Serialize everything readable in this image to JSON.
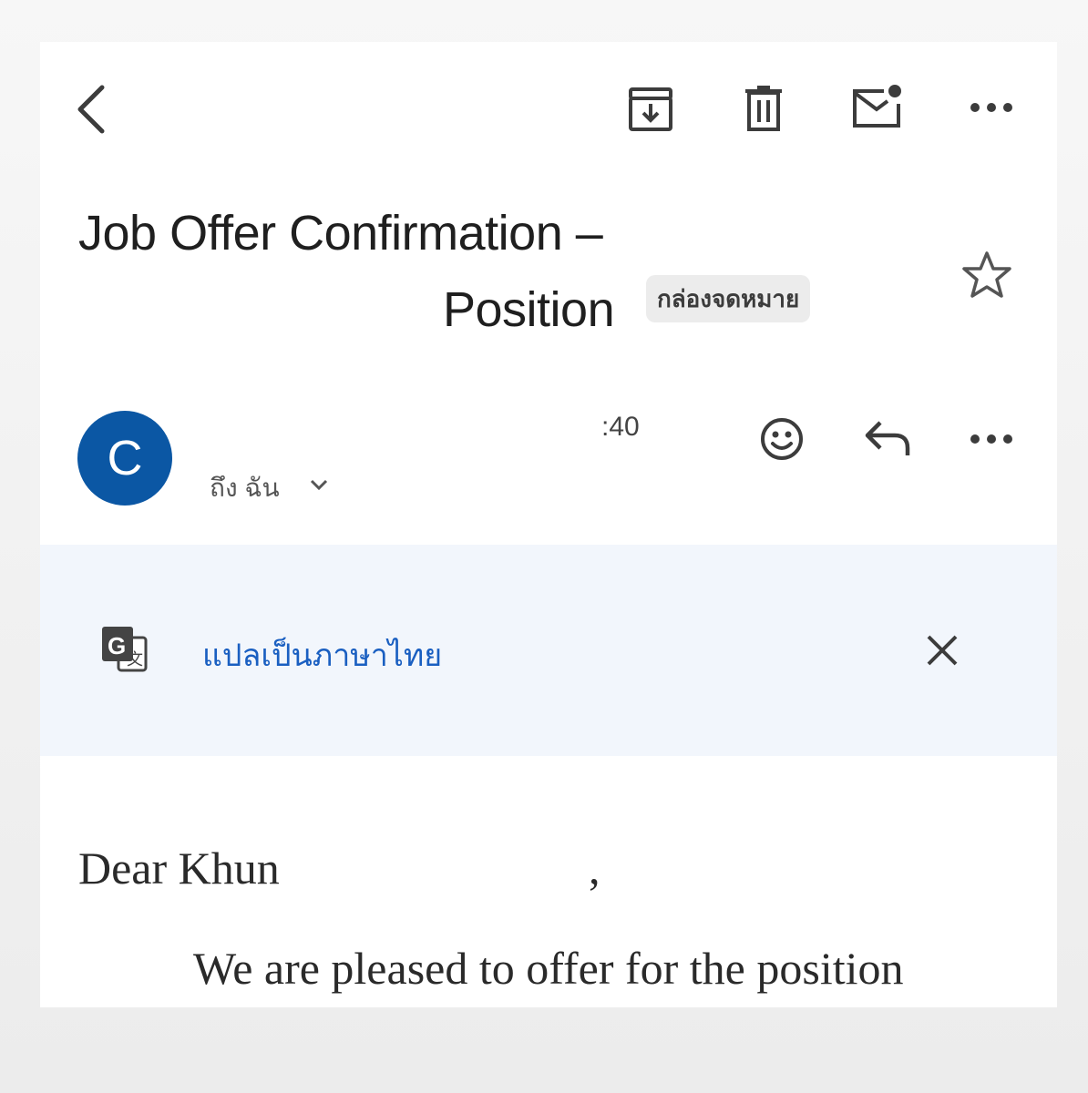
{
  "toolbar": {
    "icons": [
      "back-arrow-icon",
      "archive-icon",
      "trash-icon",
      "mark-unread-icon",
      "more-horizontal-icon"
    ]
  },
  "email": {
    "subject_line1": "Job Offer Confirmation –",
    "subject_line2": "Position",
    "label": "กล่องจดหมาย",
    "sender_initial": "C",
    "time": ":40",
    "recipient": "ถึง ฉัน",
    "avatar_color": "#0b57a4"
  },
  "translate": {
    "link": "แปลเป็นภาษาไทย",
    "link_color": "#1a5fc1",
    "background": "#f2f6fc"
  },
  "body": {
    "greeting": "Dear Khun",
    "greeting_comma": ",",
    "paragraph": "We are pleased to offer for the position"
  }
}
